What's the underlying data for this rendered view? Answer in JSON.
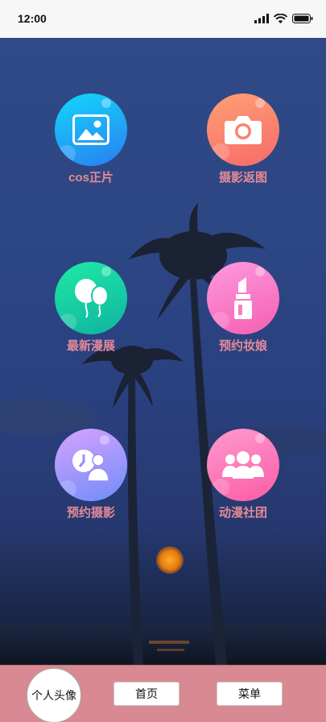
{
  "status_bar": {
    "time": "12:00"
  },
  "features": [
    {
      "label": "cos正片",
      "icon": "image-icon",
      "colors": [
        "#12d8fb",
        "#2b7ef0"
      ]
    },
    {
      "label": "摄影返图",
      "icon": "camera-icon",
      "colors": [
        "#ffa073",
        "#f76a6a"
      ]
    },
    {
      "label": "最新漫展",
      "icon": "balloons-icon",
      "colors": [
        "#1eeaa6",
        "#10b3a0"
      ]
    },
    {
      "label": "预约妆娘",
      "icon": "lipstick-icon",
      "colors": [
        "#ff9ae0",
        "#f45fb0"
      ]
    },
    {
      "label": "预约摄影",
      "icon": "users-clock-icon",
      "colors": [
        "#d7a2ff",
        "#6e8df8"
      ]
    },
    {
      "label": "动漫社团",
      "icon": "group-icon",
      "colors": [
        "#ff9ad0",
        "#fb5ca6"
      ]
    }
  ],
  "bottom_bar": {
    "avatar_label": "个人头像",
    "home_label": "首页",
    "menu_label": "菜单"
  }
}
